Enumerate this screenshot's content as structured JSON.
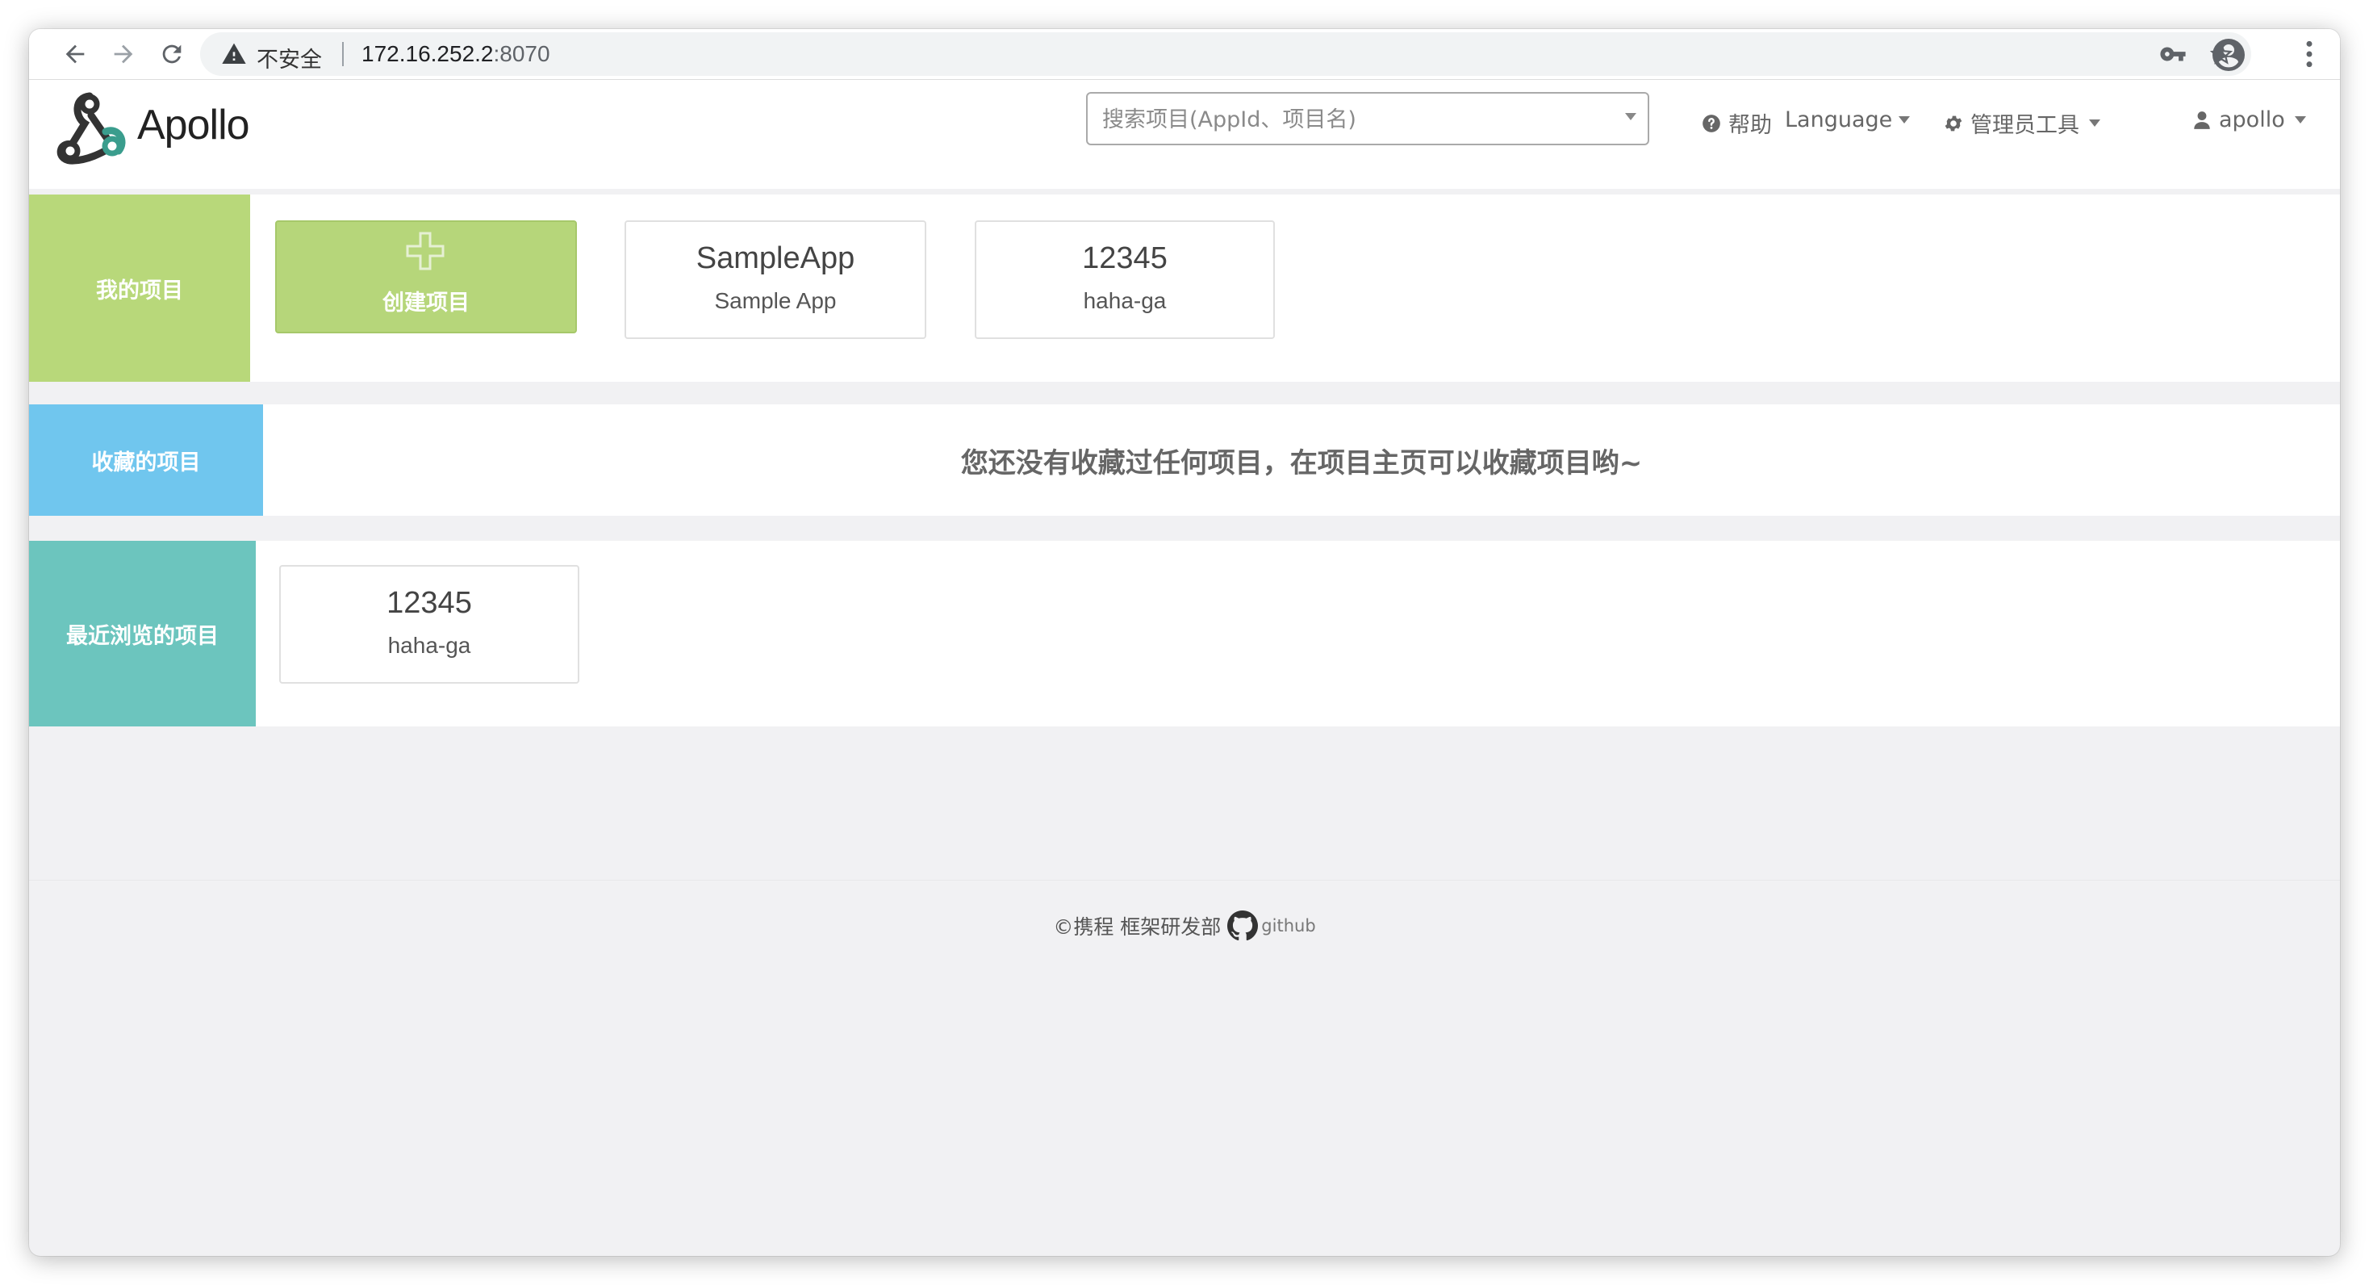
{
  "browser": {
    "security_label": "不安全",
    "url_host": "172.16.252.2",
    "url_port": ":8070"
  },
  "navbar": {
    "brand": "Apollo",
    "search_placeholder": "搜索项目(AppId、项目名)",
    "help": "帮助",
    "language": "Language",
    "admin_tools": "管理员工具",
    "user": "apollo"
  },
  "my_projects": {
    "label": "我的项目",
    "create_label": "创建项目",
    "apps": [
      {
        "app_id": "SampleApp",
        "name": "Sample App"
      },
      {
        "app_id": "12345",
        "name": "haha-ga"
      }
    ]
  },
  "favorites": {
    "label": "收藏的项目",
    "empty_message": "您还没有收藏过任何项目，在项目主页可以收藏项目哟~"
  },
  "recent": {
    "label": "最近浏览的项目",
    "apps": [
      {
        "app_id": "12345",
        "name": "haha-ga"
      }
    ]
  },
  "footer": {
    "copyright": "©携程 框架研发部",
    "github": "github"
  },
  "colors": {
    "my_projects": "#b8d87a",
    "favorites": "#70c6ee",
    "recent": "#6cc5be"
  }
}
